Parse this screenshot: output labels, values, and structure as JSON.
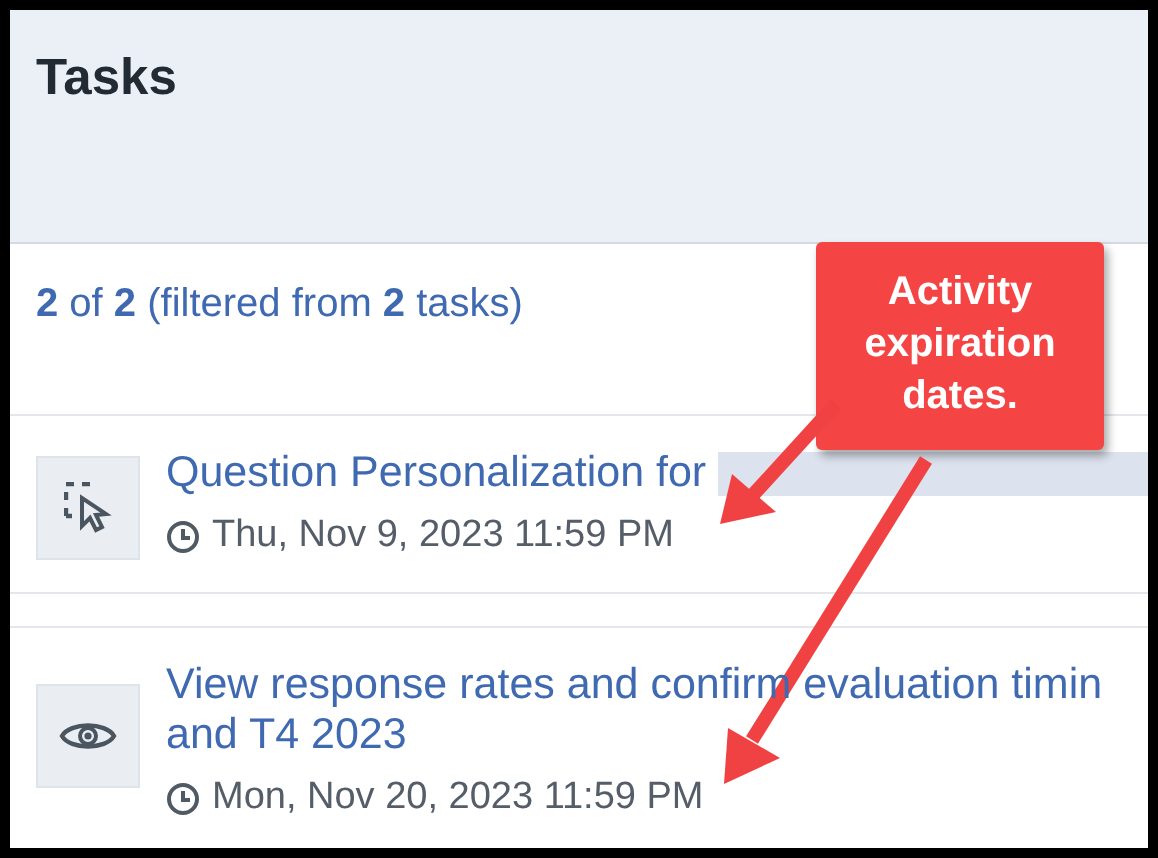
{
  "header": {
    "title": "Tasks"
  },
  "summary": "**2** of **2** (filtered from **2** tasks)",
  "tasks": [
    {
      "kind": "select",
      "title_lines": [
        "Question Personalization for"
      ],
      "redacted": true,
      "due": "Thu, Nov 9, 2023 11:59 PM"
    },
    {
      "kind": "view",
      "title_lines": [
        "View response rates and confirm evaluation timin",
        "and T4 2023"
      ],
      "redacted": false,
      "due": "Mon, Nov 20, 2023 11:59 PM"
    }
  ],
  "callout": {
    "text": "Activity expiration dates."
  }
}
